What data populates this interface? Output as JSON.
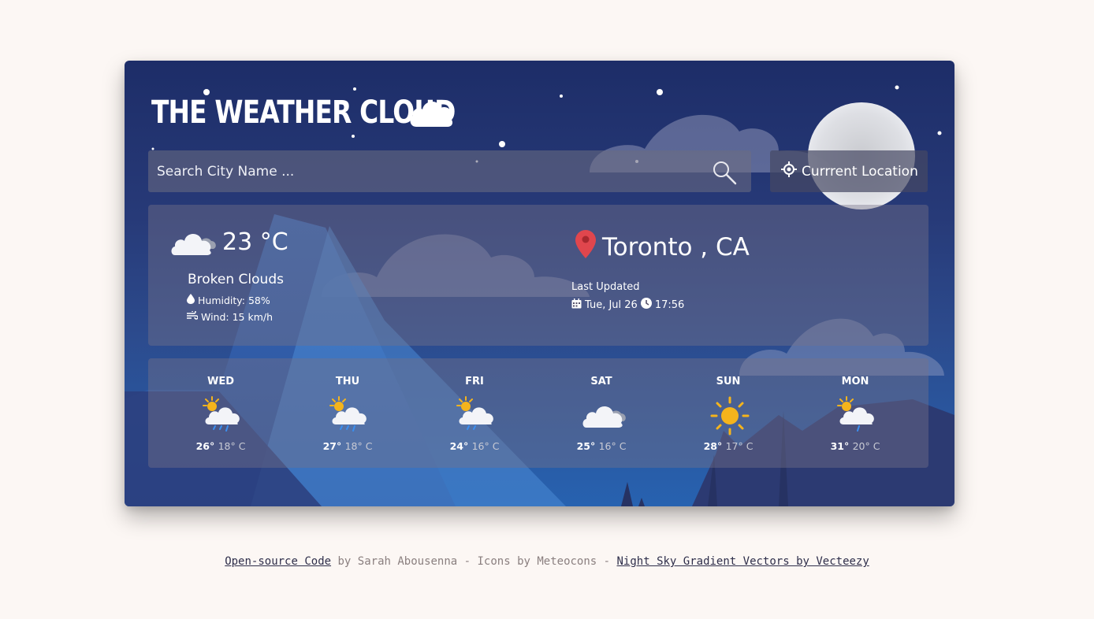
{
  "app": {
    "title": "THE WEATHER CLOUD",
    "title_icon": "cloud-icon"
  },
  "search": {
    "placeholder": "Search City Name ...",
    "icon": "search-icon"
  },
  "location_button": {
    "label": "Currrent Location",
    "icon": "crosshair-icon"
  },
  "current": {
    "temperature": "23 °C",
    "description": "Broken Clouds",
    "humidity": "Humidity: 58%",
    "wind": "Wind: 15 km/h",
    "icon": "broken-clouds-icon",
    "city": "Toronto , CA",
    "updated_label": "Last Updated",
    "updated_date": "Tue, Jul 26",
    "updated_time": "17:56"
  },
  "forecast": [
    {
      "day": "WED",
      "high": "26°",
      "low": "18° C",
      "icon": "sun-cloud-rain-icon"
    },
    {
      "day": "THU",
      "high": "27°",
      "low": "18° C",
      "icon": "sun-cloud-rain-icon"
    },
    {
      "day": "FRI",
      "high": "24°",
      "low": "16° C",
      "icon": "sun-cloud-rain-icon"
    },
    {
      "day": "SAT",
      "high": "25°",
      "low": "16° C",
      "icon": "broken-clouds-icon"
    },
    {
      "day": "SUN",
      "high": "28°",
      "low": "17° C",
      "icon": "sun-icon"
    },
    {
      "day": "MON",
      "high": "31°",
      "low": "20° C",
      "icon": "sun-cloud-rain-icon"
    }
  ],
  "footer": {
    "link1": "Open-source Code",
    "text1": " by Sarah Abousenna - Icons by Meteocons - ",
    "link2": "Night Sky Gradient Vectors by Vecteezy"
  },
  "colors": {
    "page_bg": "#fcf7f4",
    "sky_top": "#1d2d68",
    "sky_bottom": "#2762b0",
    "sun": "#f5b41c",
    "pin": "#e0464d"
  }
}
